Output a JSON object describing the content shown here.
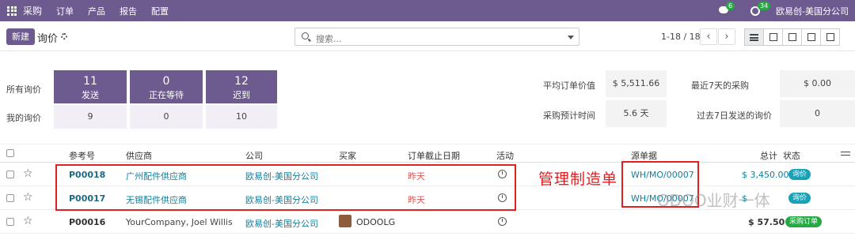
{
  "topbar": {
    "app": "采购",
    "menu": [
      "订单",
      "产品",
      "报告",
      "配置"
    ],
    "chat_count": "6",
    "activity_count": "34",
    "company": "欧易创-美国分公司"
  },
  "control": {
    "new_label": "新建",
    "title": "询价",
    "search_placeholder": "搜索...",
    "pager": "1-18 / 18"
  },
  "stats": {
    "all_label": "所有询价",
    "my_label": "我的询价",
    "tiles": [
      {
        "count": "11",
        "label": "发送",
        "mine": "9"
      },
      {
        "count": "0",
        "label": "正在等待",
        "mine": "0"
      },
      {
        "count": "12",
        "label": "迟到",
        "mine": "10"
      }
    ],
    "avg_label": "平均订单价值",
    "avg_value": "$ 5,511.66",
    "lead_label": "采购预计时间",
    "lead_value": "5.6 天",
    "last7_label": "最近7天的采购",
    "last7_value": "$ 0.00",
    "sent7_label": "过去7日发送的询价",
    "sent7_value": "0"
  },
  "table": {
    "headers": {
      "ref": "参考号",
      "vendor": "供应商",
      "company": "公司",
      "buyer": "买家",
      "deadline": "订单截止日期",
      "activity": "活动",
      "origin": "源单据",
      "total": "总计",
      "status": "状态"
    },
    "rows": [
      {
        "ref": "P00018",
        "vendor": "广州配件供应商",
        "company": "欧易创-美国分公司",
        "buyer": "",
        "deadline": "昨天",
        "origin": "WH/MO/00007",
        "total": "$ 3,450.00",
        "status": "询价"
      },
      {
        "ref": "P00017",
        "vendor": "无锡配件供应商",
        "company": "欧易创-美国分公司",
        "buyer": "",
        "deadline": "昨天",
        "origin": "WH/MO/00007",
        "total": "$",
        "status": "询价"
      },
      {
        "ref": "P00016",
        "vendor": "YourCompany, Joel Willis",
        "company": "欧易创-美国分公司",
        "buyer": "ODOOLG",
        "deadline": "",
        "origin": "",
        "total": "$ 57.50",
        "status": "采购订单"
      }
    ]
  },
  "annotation": "管理制造单",
  "watermark": "ODOO业财一体",
  "colors": {
    "primary": "#6d5a8f",
    "link": "#0f7f9b",
    "overdue": "#d9534f",
    "rfq_badge": "#17a2b8",
    "po_badge": "#28a745",
    "annotation": "#e02020"
  }
}
